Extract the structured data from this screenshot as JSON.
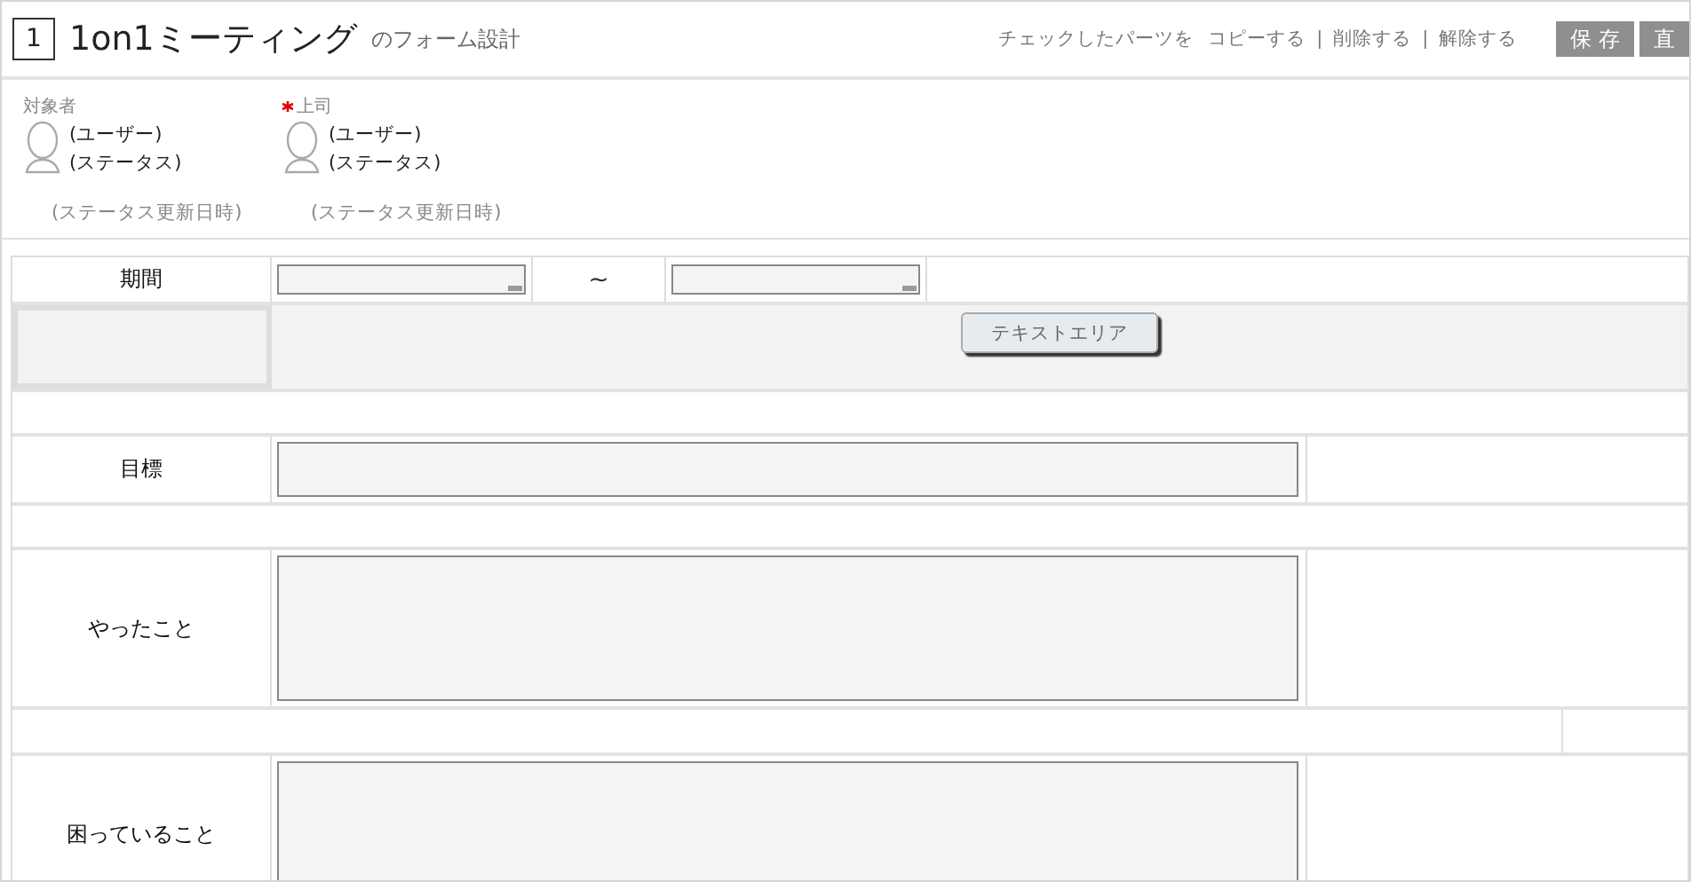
{
  "header": {
    "number": "1",
    "title": "1on1ミーティング",
    "subtitle": "のフォーム設計",
    "actions_label": "チェックしたパーツを",
    "actions": [
      "コピーする",
      "削除する",
      "解除する"
    ],
    "separators": [
      "|",
      "|"
    ],
    "buttons": [
      {
        "label": "保 存",
        "disabled": true
      },
      {
        "label": "直",
        "disabled": true
      }
    ]
  },
  "people": [
    {
      "label": "対象者",
      "required": false,
      "user": "(ユーザー)",
      "status": "(ステータス)",
      "updated": "(ステータス更新日時)"
    },
    {
      "label": "上司",
      "required": true,
      "user": "(ユーザー)",
      "status": "(ステータス)",
      "updated": "(ステータス更新日時)"
    }
  ],
  "form_rows": [
    {
      "kind": "date_range",
      "label": "期間",
      "separator": "~"
    },
    {
      "kind": "palette",
      "button": "テキストエリア"
    },
    {
      "kind": "spacer"
    },
    {
      "kind": "input",
      "label": "目標"
    },
    {
      "kind": "spacer"
    },
    {
      "kind": "textarea",
      "label": "やったこと"
    },
    {
      "kind": "spacer_split"
    },
    {
      "kind": "textarea",
      "label": "困っていること"
    }
  ]
}
